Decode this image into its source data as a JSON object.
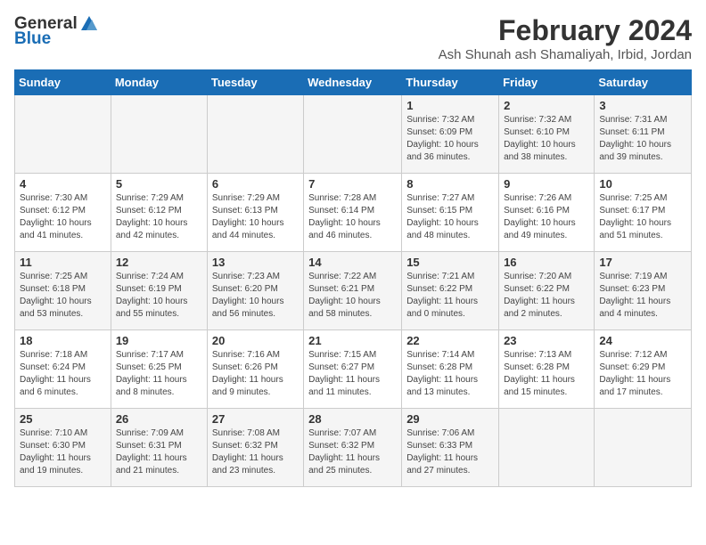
{
  "logo": {
    "general": "General",
    "blue": "Blue"
  },
  "title": "February 2024",
  "subtitle": "Ash Shunah ash Shamaliyah, Irbid, Jordan",
  "days_of_week": [
    "Sunday",
    "Monday",
    "Tuesday",
    "Wednesday",
    "Thursday",
    "Friday",
    "Saturday"
  ],
  "weeks": [
    [
      {
        "day": "",
        "content": ""
      },
      {
        "day": "",
        "content": ""
      },
      {
        "day": "",
        "content": ""
      },
      {
        "day": "",
        "content": ""
      },
      {
        "day": "1",
        "content": "Sunrise: 7:32 AM\nSunset: 6:09 PM\nDaylight: 10 hours\nand 36 minutes."
      },
      {
        "day": "2",
        "content": "Sunrise: 7:32 AM\nSunset: 6:10 PM\nDaylight: 10 hours\nand 38 minutes."
      },
      {
        "day": "3",
        "content": "Sunrise: 7:31 AM\nSunset: 6:11 PM\nDaylight: 10 hours\nand 39 minutes."
      }
    ],
    [
      {
        "day": "4",
        "content": "Sunrise: 7:30 AM\nSunset: 6:12 PM\nDaylight: 10 hours\nand 41 minutes."
      },
      {
        "day": "5",
        "content": "Sunrise: 7:29 AM\nSunset: 6:12 PM\nDaylight: 10 hours\nand 42 minutes."
      },
      {
        "day": "6",
        "content": "Sunrise: 7:29 AM\nSunset: 6:13 PM\nDaylight: 10 hours\nand 44 minutes."
      },
      {
        "day": "7",
        "content": "Sunrise: 7:28 AM\nSunset: 6:14 PM\nDaylight: 10 hours\nand 46 minutes."
      },
      {
        "day": "8",
        "content": "Sunrise: 7:27 AM\nSunset: 6:15 PM\nDaylight: 10 hours\nand 48 minutes."
      },
      {
        "day": "9",
        "content": "Sunrise: 7:26 AM\nSunset: 6:16 PM\nDaylight: 10 hours\nand 49 minutes."
      },
      {
        "day": "10",
        "content": "Sunrise: 7:25 AM\nSunset: 6:17 PM\nDaylight: 10 hours\nand 51 minutes."
      }
    ],
    [
      {
        "day": "11",
        "content": "Sunrise: 7:25 AM\nSunset: 6:18 PM\nDaylight: 10 hours\nand 53 minutes."
      },
      {
        "day": "12",
        "content": "Sunrise: 7:24 AM\nSunset: 6:19 PM\nDaylight: 10 hours\nand 55 minutes."
      },
      {
        "day": "13",
        "content": "Sunrise: 7:23 AM\nSunset: 6:20 PM\nDaylight: 10 hours\nand 56 minutes."
      },
      {
        "day": "14",
        "content": "Sunrise: 7:22 AM\nSunset: 6:21 PM\nDaylight: 10 hours\nand 58 minutes."
      },
      {
        "day": "15",
        "content": "Sunrise: 7:21 AM\nSunset: 6:22 PM\nDaylight: 11 hours\nand 0 minutes."
      },
      {
        "day": "16",
        "content": "Sunrise: 7:20 AM\nSunset: 6:22 PM\nDaylight: 11 hours\nand 2 minutes."
      },
      {
        "day": "17",
        "content": "Sunrise: 7:19 AM\nSunset: 6:23 PM\nDaylight: 11 hours\nand 4 minutes."
      }
    ],
    [
      {
        "day": "18",
        "content": "Sunrise: 7:18 AM\nSunset: 6:24 PM\nDaylight: 11 hours\nand 6 minutes."
      },
      {
        "day": "19",
        "content": "Sunrise: 7:17 AM\nSunset: 6:25 PM\nDaylight: 11 hours\nand 8 minutes."
      },
      {
        "day": "20",
        "content": "Sunrise: 7:16 AM\nSunset: 6:26 PM\nDaylight: 11 hours\nand 9 minutes."
      },
      {
        "day": "21",
        "content": "Sunrise: 7:15 AM\nSunset: 6:27 PM\nDaylight: 11 hours\nand 11 minutes."
      },
      {
        "day": "22",
        "content": "Sunrise: 7:14 AM\nSunset: 6:28 PM\nDaylight: 11 hours\nand 13 minutes."
      },
      {
        "day": "23",
        "content": "Sunrise: 7:13 AM\nSunset: 6:28 PM\nDaylight: 11 hours\nand 15 minutes."
      },
      {
        "day": "24",
        "content": "Sunrise: 7:12 AM\nSunset: 6:29 PM\nDaylight: 11 hours\nand 17 minutes."
      }
    ],
    [
      {
        "day": "25",
        "content": "Sunrise: 7:10 AM\nSunset: 6:30 PM\nDaylight: 11 hours\nand 19 minutes."
      },
      {
        "day": "26",
        "content": "Sunrise: 7:09 AM\nSunset: 6:31 PM\nDaylight: 11 hours\nand 21 minutes."
      },
      {
        "day": "27",
        "content": "Sunrise: 7:08 AM\nSunset: 6:32 PM\nDaylight: 11 hours\nand 23 minutes."
      },
      {
        "day": "28",
        "content": "Sunrise: 7:07 AM\nSunset: 6:32 PM\nDaylight: 11 hours\nand 25 minutes."
      },
      {
        "day": "29",
        "content": "Sunrise: 7:06 AM\nSunset: 6:33 PM\nDaylight: 11 hours\nand 27 minutes."
      },
      {
        "day": "",
        "content": ""
      },
      {
        "day": "",
        "content": ""
      }
    ]
  ]
}
